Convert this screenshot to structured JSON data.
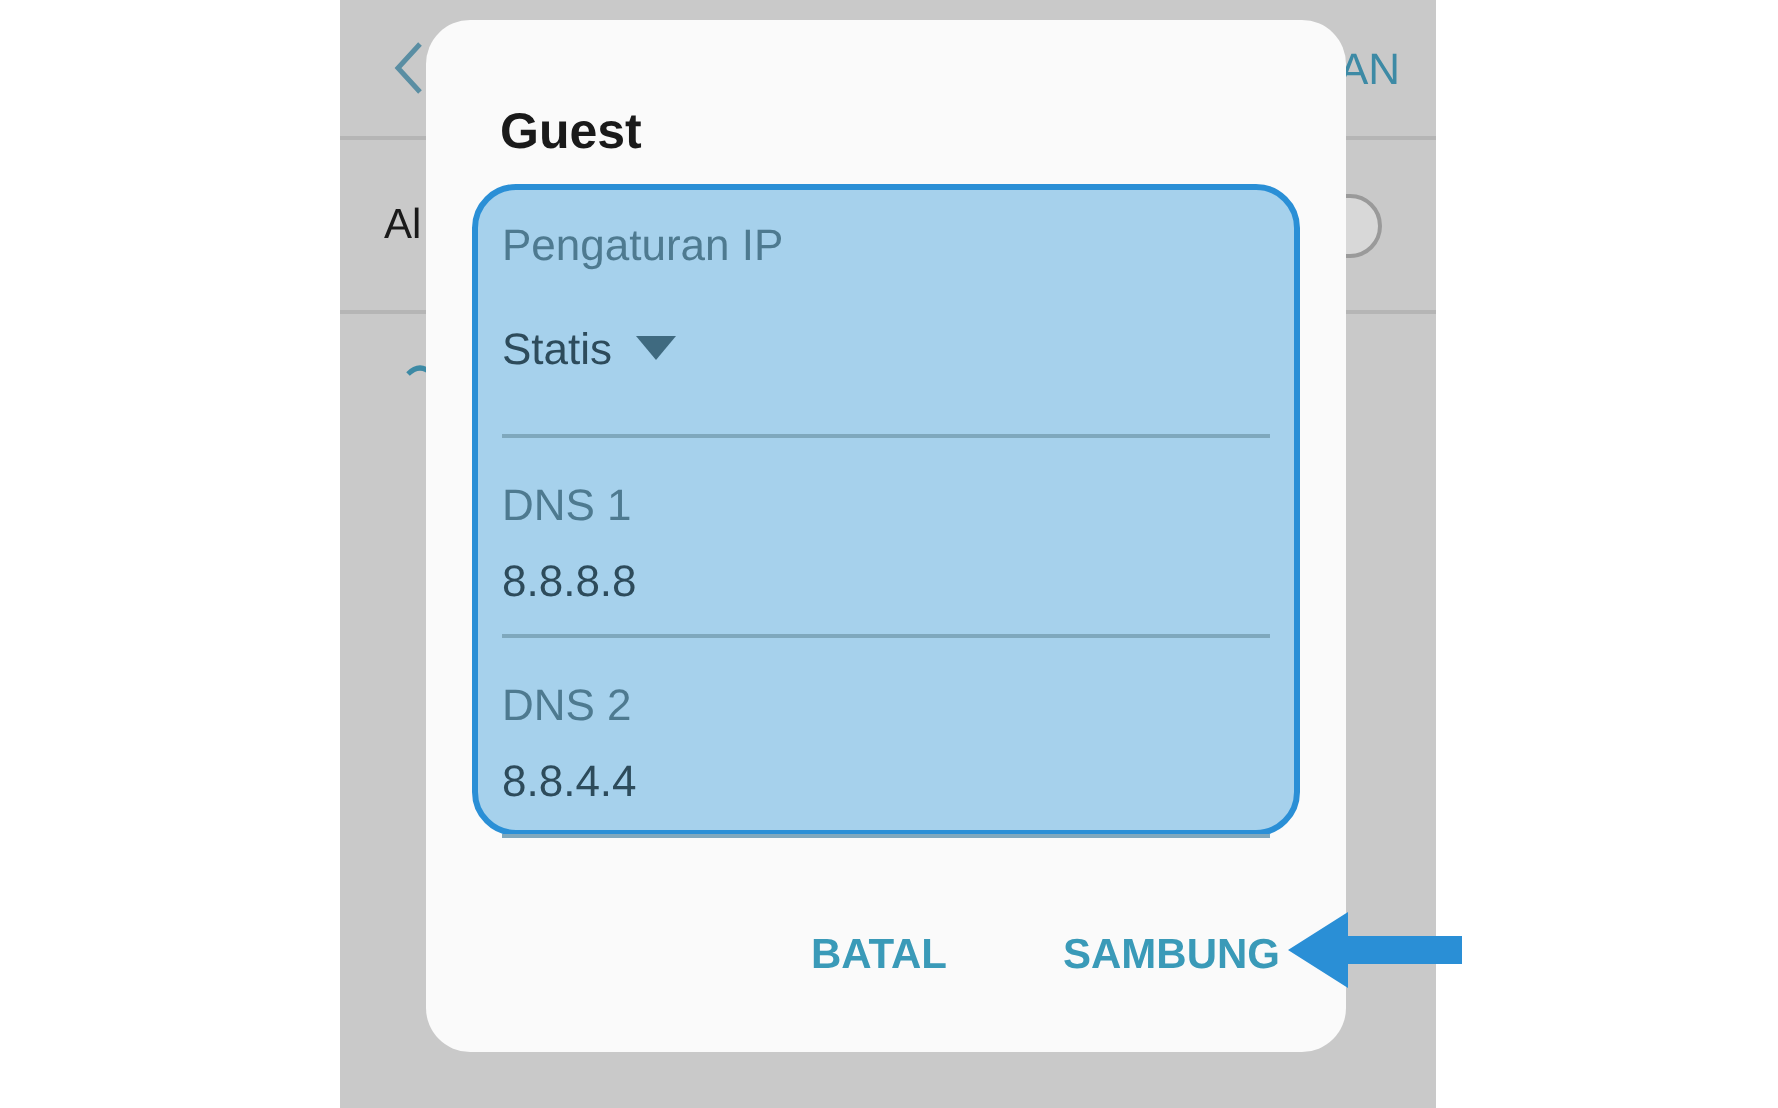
{
  "background": {
    "header_action": "AN",
    "row_label": "Al",
    "toggle": {
      "on": false
    }
  },
  "dialog": {
    "title": "Guest",
    "ip_settings": {
      "label": "Pengaturan IP",
      "value": "Statis"
    },
    "fields": [
      {
        "label": "DNS 1",
        "value": "8.8.8.8"
      },
      {
        "label": "DNS 2",
        "value": "8.8.4.4"
      }
    ],
    "buttons": [
      "BATAL",
      "SAMBUNG"
    ]
  }
}
